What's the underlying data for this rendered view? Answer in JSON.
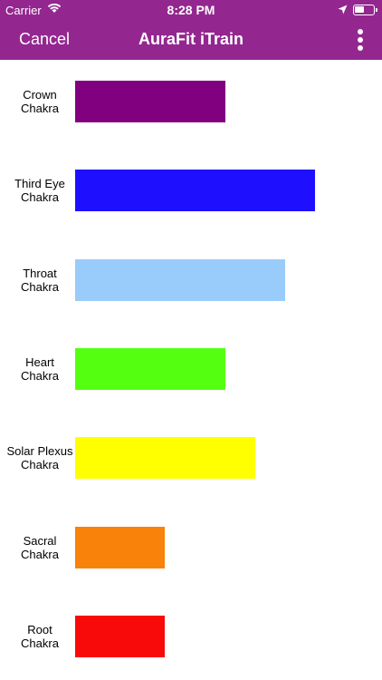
{
  "status_bar": {
    "carrier": "Carrier",
    "time": "8:28 PM",
    "battery_level": 0.5
  },
  "nav": {
    "cancel_label": "Cancel",
    "title": "AuraFit iTrain"
  },
  "colors": {
    "nav_background": "#93278f"
  },
  "icons": [
    "wifi-icon",
    "location-arrow-icon",
    "battery-icon",
    "more-vertical-icon"
  ],
  "chart_data": {
    "type": "bar",
    "orientation": "horizontal",
    "categories": [
      "Crown\nChakra",
      "Third Eye\nChakra",
      "Throat\nChakra",
      "Heart\nChakra",
      "Solar Plexus\nChakra",
      "Sacral\nChakra",
      "Root\nChakra"
    ],
    "values": [
      5,
      8,
      7,
      5,
      6,
      3,
      3
    ],
    "colors": [
      "#800080",
      "#1e10ff",
      "#99ccfa",
      "#55ff10",
      "#ffff00",
      "#f8820a",
      "#f80a0a"
    ],
    "xlim": [
      0,
      10
    ],
    "grid": false,
    "legend": false
  }
}
